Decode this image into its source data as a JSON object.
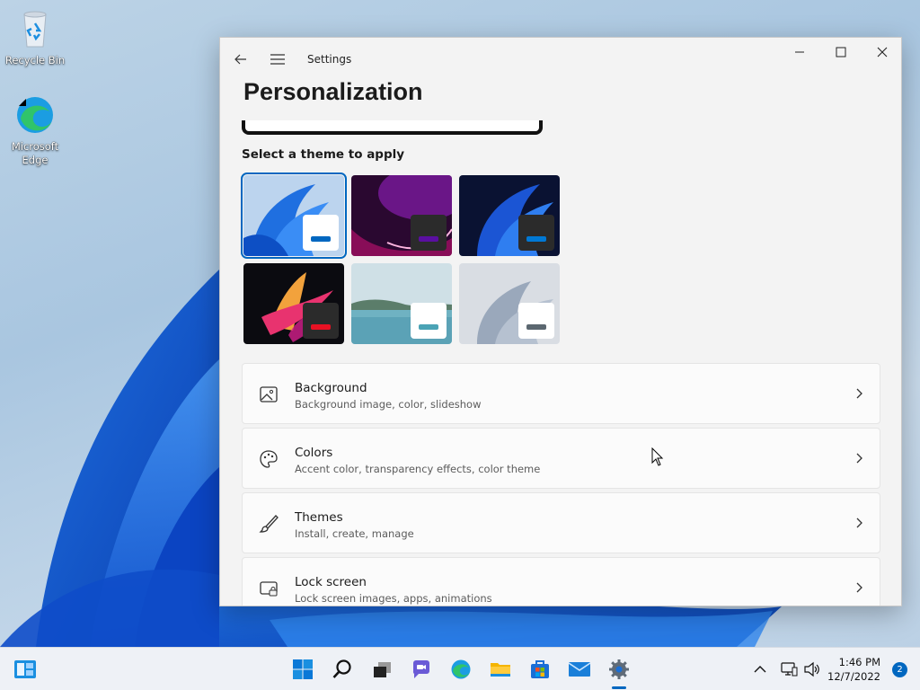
{
  "desktop": {
    "icons": [
      {
        "label": "Recycle Bin",
        "icon": "recycle-bin-icon"
      },
      {
        "label": "Microsoft Edge",
        "icon": "edge-icon"
      }
    ]
  },
  "window": {
    "app_title": "Settings",
    "page_title": "Personalization",
    "section_label": "Select a theme to apply",
    "themes": [
      {
        "name": "windows-light",
        "accent": "#0067c0",
        "selected": true
      },
      {
        "name": "glow",
        "accent": "#5a0fa0",
        "selected": false
      },
      {
        "name": "windows-dark",
        "accent": "#0078d4",
        "selected": false
      },
      {
        "name": "captured-motion",
        "accent": "#e81123",
        "selected": false
      },
      {
        "name": "sunrise",
        "accent": "#4aa3b5",
        "selected": false
      },
      {
        "name": "flow",
        "accent": "#5b6770",
        "selected": false
      }
    ],
    "settings": [
      {
        "title": "Background",
        "subtitle": "Background image, color, slideshow",
        "icon": "image-icon"
      },
      {
        "title": "Colors",
        "subtitle": "Accent color, transparency effects, color theme",
        "icon": "palette-icon"
      },
      {
        "title": "Themes",
        "subtitle": "Install, create, manage",
        "icon": "brush-icon"
      },
      {
        "title": "Lock screen",
        "subtitle": "Lock screen images, apps, animations",
        "icon": "lock-screen-icon"
      }
    ]
  },
  "taskbar": {
    "apps": [
      "widgets-icon",
      "start-icon",
      "search-icon",
      "task-view-icon",
      "chat-icon",
      "edge-icon",
      "file-explorer-icon",
      "store-icon",
      "mail-icon",
      "settings-icon"
    ],
    "time": "1:46 PM",
    "date": "12/7/2022",
    "notification_count": "2"
  },
  "colors": {
    "accent": "#0067c0"
  }
}
